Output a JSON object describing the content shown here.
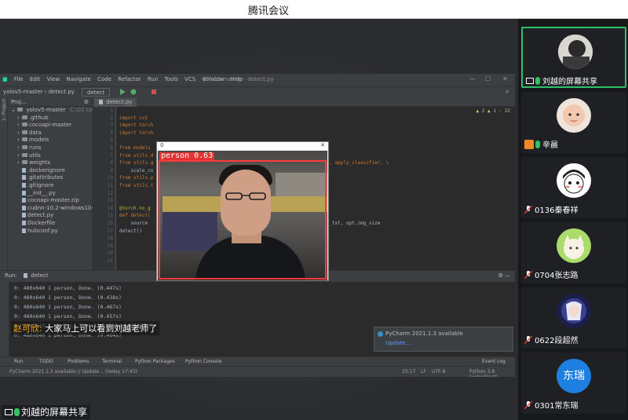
{
  "window": {
    "title": "腾讯会议"
  },
  "pycharm": {
    "window_title": "yolov5-master - detect.py",
    "menu": [
      "File",
      "Edit",
      "View",
      "Navigate",
      "Code",
      "Refactor",
      "Run",
      "Tools",
      "VCS",
      "Window",
      "Help"
    ],
    "breadcrumb": [
      "yolov5-master",
      "detect.py"
    ],
    "run_config": "detect",
    "project_title": "Proj...",
    "tree_root": "yolov5-master",
    "tree_root_path": "C:\\02 code\\",
    "tree": [
      ".github",
      "cocoapi-master",
      "data",
      "models",
      "runs",
      "utils",
      "weights",
      ".dockerignore",
      ".gitattributes",
      ".gitignore",
      "__init__.py",
      "cocoapi-master.zip",
      "cudnn-10.2-windows10-x",
      "detect.py",
      "Dockerfile",
      "hubconf.py"
    ],
    "editor_tab": "detect.py",
    "inspections": {
      "warnings": "2",
      "weak": "1",
      "typos": "22"
    },
    "line_numbers": [
      "1",
      "2",
      "3",
      "4",
      "5",
      "6",
      "7",
      "8",
      "9",
      "10",
      "11",
      "12",
      "13",
      "14",
      "15",
      "16",
      "17",
      "18",
      "19",
      "20",
      "21"
    ],
    "code_lines": [
      "",
      "import cv2",
      "import torch",
      "import torch",
      "",
      "from models",
      "from utils.d",
      "from utils.g                                      hoe, non_max_suppression, apply_classifier, \\",
      "    scale_co                                      ath, save_one_box",
      "from utils.p",
      "from utils.t                                      chronized",
      "",
      "",
      "@torch.no_g",
      "def detect(",
      "    source                                        , opt.view_img, opt.save_txt, opt.img_size",
      "detect()"
    ],
    "run_label": "Run:",
    "run_tab": "detect",
    "run_output": [
      "0: 480x640 1 person, Done. (0.447s)",
      "0: 480x640 1 person, Done. (0.438s)",
      "0: 480x640 1 person, Done. (0.467s)",
      "0: 480x640 1 person, Done. (0.457s)",
      "0: 480x640 1 person, 1 bottle, Done. (0.495s)",
      "0: 480x640 1 person, Done. (0.464s)"
    ],
    "notification": {
      "title": "PyCharm 2021.1.3 available",
      "link": "Update..."
    },
    "tool_windows": [
      "Run",
      "TODO",
      "Problems",
      "Terminal",
      "Python Packages",
      "Python Console",
      "Event Log"
    ],
    "status": {
      "left": "PyCharm 2021.1.3 available // Update... (today 17:43)",
      "position": "33:17",
      "line_sep": "LF",
      "encoding": "UTF-8",
      "indent": "4 spaces",
      "interpreter": "Python 3.8 (yolov5test)"
    }
  },
  "webcam": {
    "title": "0",
    "label": "person 0.63",
    "box_color": "#ff3b3b"
  },
  "subtitle": {
    "speaker": "赵可欣:",
    "text": "大家马上可以看到刘越老师了"
  },
  "share_tag": "刘越的屏幕共享",
  "participants": [
    {
      "name": "刘越的屏幕共享",
      "avatar": "photo-dark",
      "icon": "screen-share-icon",
      "active": true
    },
    {
      "name": "辛晨",
      "avatar": "photo-baby",
      "icon": "host-icon"
    },
    {
      "name": "0136秦春祥",
      "avatar": "cartoon-boy",
      "icon": "muted-mic-icon"
    },
    {
      "name": "0704张志路",
      "avatar": "cartoon-cat",
      "icon": "muted-mic-icon"
    },
    {
      "name": "0622段超然",
      "avatar": "anime-girl",
      "icon": "muted-mic-icon"
    },
    {
      "name": "0301常东瑞",
      "avatar_text": "东瑞",
      "avatar_color": "#1d7fe0",
      "icon": "muted-mic-icon"
    }
  ],
  "colors": {
    "accent_green": "#2fbf6b",
    "subtitle_speaker": "#f5a623",
    "link": "#589df6"
  }
}
